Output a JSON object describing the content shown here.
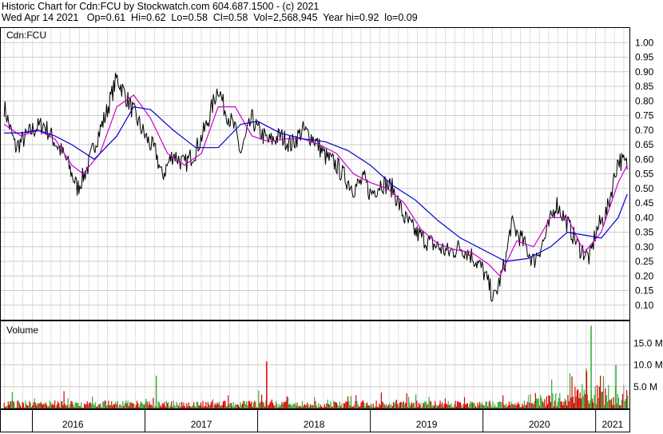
{
  "header": {
    "line1": "Historic Chart for Cdn:FCU by Stockwatch.com 604.687.1500 - (c) 2021",
    "line2": "Wed Apr 14 2021   Op=0.61  Hi=0.62  Lo=0.58  Cl=0.58  Vol=2,568,945  Year hi=0.92  lo=0.09"
  },
  "colors": {
    "price": "#000000",
    "ma_short": "#cc00cc",
    "ma_long": "#0000cc",
    "vol_up": "#33aa33",
    "vol_down": "#dd0000",
    "vol_neutral": "#999999",
    "grid": "#cccccc"
  },
  "chart_data": [
    {
      "type": "line",
      "title": "Cdn:FCU",
      "ylim": [
        0.05,
        1.05
      ],
      "y_ticks": [
        "1.00",
        "0.95",
        "0.90",
        "0.85",
        "0.80",
        "0.75",
        "0.70",
        "0.65",
        "0.60",
        "0.55",
        "0.50",
        "0.45",
        "0.40",
        "0.35",
        "0.30",
        "0.25",
        "0.20",
        "0.15",
        "0.10"
      ],
      "x_ticks": [
        "2016",
        "2017",
        "2018",
        "2019",
        "2020",
        "2021"
      ],
      "grid": true,
      "series": [
        {
          "x": [
            2015.75,
            2015.85,
            2016.0,
            2016.1,
            2016.2,
            2016.3,
            2016.4,
            2016.5,
            2016.55,
            2016.65,
            2016.75,
            2016.85,
            2016.95,
            2017.0,
            2017.1,
            2017.15,
            2017.25,
            2017.35,
            2017.45,
            2017.55,
            2017.65,
            2017.7,
            2017.8,
            2017.85,
            2017.95,
            2018.0,
            2018.1,
            2018.2,
            2018.3,
            2018.4,
            2018.5,
            2018.6,
            2018.7,
            2018.75,
            2018.85,
            2018.95,
            2019.0,
            2019.1,
            2019.2,
            2019.3,
            2019.4,
            2019.5,
            2019.6,
            2019.7,
            2019.8,
            2019.9,
            2020.0,
            2020.1,
            2020.2,
            2020.25,
            2020.35,
            2020.45,
            2020.55,
            2020.65,
            2020.75,
            2020.85,
            2020.95,
            2021.0,
            2021.1,
            2021.2,
            2021.28
          ],
          "values": [
            0.78,
            0.64,
            0.7,
            0.72,
            0.66,
            0.6,
            0.5,
            0.58,
            0.65,
            0.75,
            0.88,
            0.8,
            0.72,
            0.68,
            0.62,
            0.54,
            0.62,
            0.58,
            0.63,
            0.72,
            0.85,
            0.78,
            0.7,
            0.62,
            0.74,
            0.7,
            0.66,
            0.68,
            0.65,
            0.7,
            0.67,
            0.61,
            0.58,
            0.55,
            0.5,
            0.53,
            0.48,
            0.52,
            0.5,
            0.4,
            0.35,
            0.32,
            0.3,
            0.28,
            0.3,
            0.27,
            0.22,
            0.12,
            0.25,
            0.38,
            0.32,
            0.25,
            0.33,
            0.45,
            0.38,
            0.3,
            0.26,
            0.35,
            0.42,
            0.6,
            0.58
          ]
        },
        {
          "x": [
            2015.75,
            2015.9,
            2016.05,
            2016.2,
            2016.35,
            2016.45,
            2016.6,
            2016.75,
            2016.9,
            2017.05,
            2017.2,
            2017.35,
            2017.5,
            2017.65,
            2017.8,
            2017.95,
            2018.1,
            2018.25,
            2018.4,
            2018.55,
            2018.7,
            2018.85,
            2019.0,
            2019.15,
            2019.3,
            2019.45,
            2019.6,
            2019.75,
            2019.9,
            2020.05,
            2020.15,
            2020.3,
            2020.45,
            2020.6,
            2020.75,
            2020.9,
            2021.05,
            2021.2,
            2021.28
          ],
          "values": [
            0.72,
            0.68,
            0.7,
            0.67,
            0.58,
            0.55,
            0.62,
            0.78,
            0.82,
            0.74,
            0.62,
            0.58,
            0.62,
            0.78,
            0.78,
            0.68,
            0.66,
            0.67,
            0.67,
            0.65,
            0.62,
            0.55,
            0.52,
            0.5,
            0.45,
            0.36,
            0.31,
            0.29,
            0.28,
            0.24,
            0.2,
            0.32,
            0.3,
            0.4,
            0.4,
            0.28,
            0.35,
            0.52,
            0.58
          ]
        },
        {
          "x": [
            2015.75,
            2015.9,
            2016.05,
            2016.2,
            2016.35,
            2016.55,
            2016.75,
            2016.9,
            2017.05,
            2017.25,
            2017.45,
            2017.65,
            2017.85,
            2018.0,
            2018.2,
            2018.4,
            2018.6,
            2018.8,
            2019.0,
            2019.2,
            2019.4,
            2019.6,
            2019.8,
            2020.0,
            2020.2,
            2020.4,
            2020.6,
            2020.75,
            2020.9,
            2021.05,
            2021.2,
            2021.28
          ],
          "values": [
            0.69,
            0.69,
            0.7,
            0.68,
            0.65,
            0.6,
            0.68,
            0.78,
            0.77,
            0.7,
            0.64,
            0.64,
            0.72,
            0.73,
            0.69,
            0.67,
            0.66,
            0.63,
            0.58,
            0.51,
            0.46,
            0.39,
            0.33,
            0.29,
            0.25,
            0.26,
            0.3,
            0.35,
            0.34,
            0.33,
            0.4,
            0.48
          ]
        }
      ]
    },
    {
      "type": "bar",
      "title": "Volume",
      "ylim": [
        0,
        20000000
      ],
      "y_ticks": [
        "15.0 M",
        "10.0 M",
        "5.0 M"
      ],
      "highlights": [
        {
          "x": 2017.1,
          "value": 7500000
        },
        {
          "x": 2018.08,
          "value": 10800000
        },
        {
          "x": 2020.96,
          "value": 19000000
        },
        {
          "x": 2020.92,
          "value": 8500000
        },
        {
          "x": 2021.18,
          "value": 10000000
        }
      ]
    }
  ]
}
